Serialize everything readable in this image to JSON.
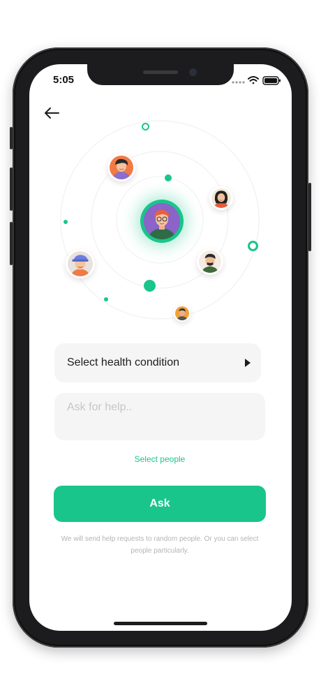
{
  "status_bar": {
    "time": "5:05"
  },
  "icons": {
    "back": "arrow-left-icon",
    "play": "play-triangle-icon",
    "wifi": "wifi-icon",
    "battery": "battery-icon",
    "signal": "signal-icon"
  },
  "form": {
    "health_condition_label": "Select health condition",
    "help_placeholder": "Ask for help..",
    "select_people_label": "Select people",
    "ask_button_label": "Ask",
    "info_text": "We will send help requests to random people. Or you can select people particularly."
  },
  "colors": {
    "accent": "#19c58a",
    "field_bg": "#f5f5f6",
    "placeholder": "#c6c6c8",
    "muted_text": "#b4b4b6"
  }
}
